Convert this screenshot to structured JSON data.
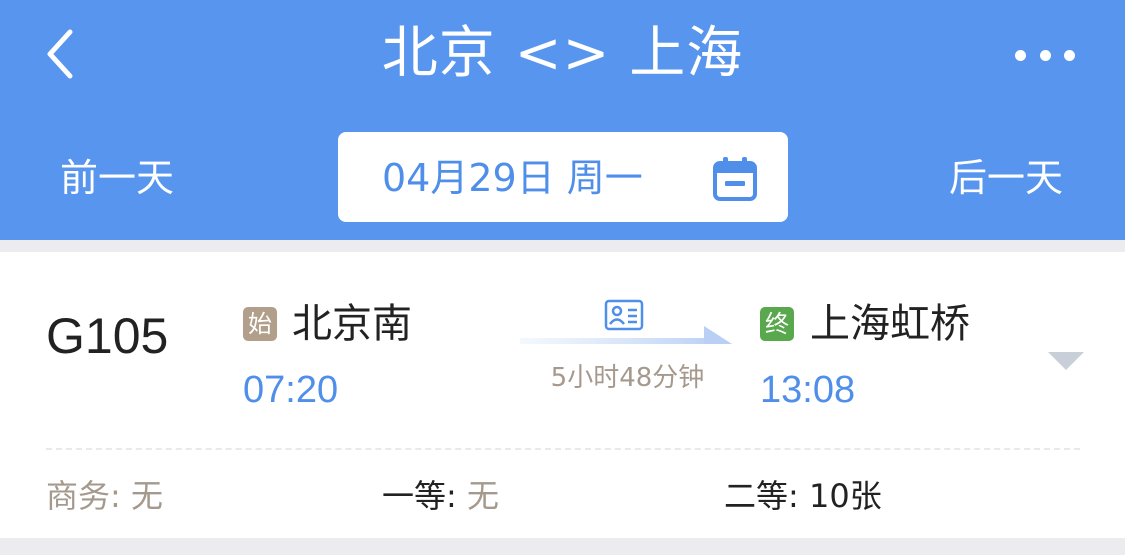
{
  "header": {
    "title": "北京 <> 上海",
    "prev_day": "前一天",
    "next_day": "后一天",
    "date": "04月29日 周一"
  },
  "train": {
    "number": "G105",
    "from": {
      "badge": "始",
      "station": "北京南",
      "time": "07:20"
    },
    "to": {
      "badge": "终",
      "station": "上海虹桥",
      "time": "13:08"
    },
    "duration": "5小时48分钟"
  },
  "seats": [
    {
      "label": "商务: ",
      "value": "无"
    },
    {
      "label": "一等: ",
      "value": "无"
    },
    {
      "label": "二等: ",
      "value": "10张"
    }
  ],
  "colors": {
    "header_bg": "#5795ee",
    "accent": "#4f8fe9",
    "start_badge": "#b19f8b",
    "end_badge": "#5aa84e",
    "muted": "#a5998d"
  },
  "icons": [
    "back-arrow-icon",
    "more-icon",
    "calendar-icon",
    "id-card-icon",
    "arrow-right-icon",
    "chevron-down-icon"
  ]
}
